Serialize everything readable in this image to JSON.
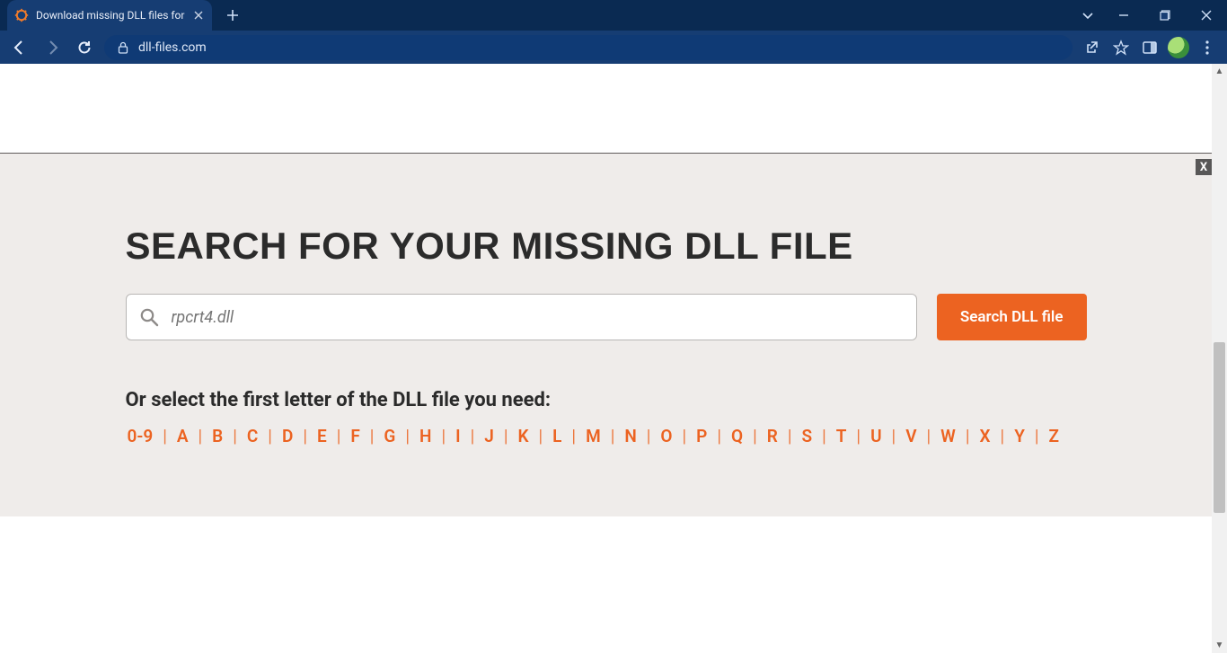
{
  "browser": {
    "tab_title": "Download missing DLL files for fr",
    "url": "dll-files.com"
  },
  "page": {
    "hero_title": "SEARCH FOR YOUR MISSING DLL FILE",
    "search_placeholder": "rpcrt4.dll",
    "search_button": "Search DLL file",
    "letter_prompt": "Or select the first letter of the DLL file you need:",
    "letters": [
      "0-9",
      "A",
      "B",
      "C",
      "D",
      "E",
      "F",
      "G",
      "H",
      "I",
      "J",
      "K",
      "L",
      "M",
      "N",
      "O",
      "P",
      "Q",
      "R",
      "S",
      "T",
      "U",
      "V",
      "W",
      "X",
      "Y",
      "Z"
    ],
    "close_ad_label": "X"
  },
  "colors": {
    "accent": "#ec6321"
  }
}
